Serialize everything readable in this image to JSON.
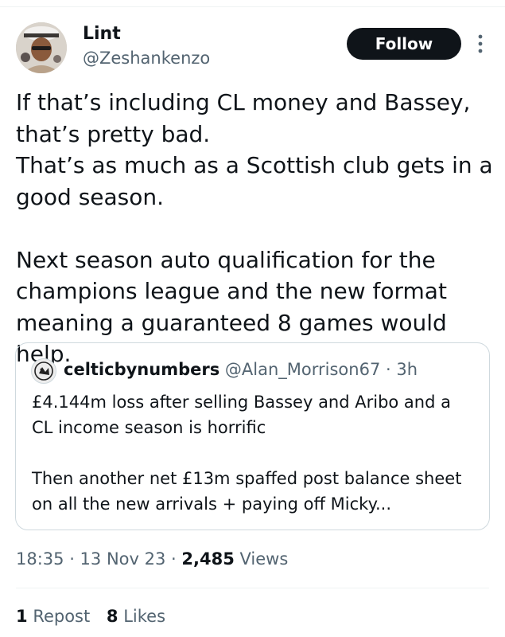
{
  "tweet": {
    "author": {
      "display_name": "Lint",
      "handle": "@Zeshankenzo"
    },
    "follow_label": "Follow",
    "text": "If that’s including CL money and Bassey, that’s pretty bad.\nThat’s as much as a Scottish club gets in a good season.\n\nNext season auto qualification for the champions league and the new format meaning a guaranteed 8 games would help.",
    "timestamp": "18:35 · 13 Nov 23",
    "meta_sep": "·",
    "views_count": "2,485",
    "views_label": "Views"
  },
  "quote": {
    "name": "celticbynumbers",
    "handle": "@Alan_Morrison67",
    "sep": "·",
    "time": "3h",
    "text": "£4.144m loss after selling Bassey and Aribo and a CL income season is horrific\n\nThen another net £13m spaffed post balance sheet on all the new arrivals + paying off Micky..."
  },
  "stats": {
    "reposts_count": "1",
    "reposts_label": "Repost",
    "likes_count": "8",
    "likes_label": "Likes"
  },
  "icons": {
    "more": "more-vertical-icon",
    "avatar": "user-avatar",
    "quote_avatar": "celtic-crest-avatar"
  },
  "colors": {
    "text": "#0f1419",
    "secondary": "#536471",
    "border": "#cfd9de",
    "button": "#0f1419"
  }
}
